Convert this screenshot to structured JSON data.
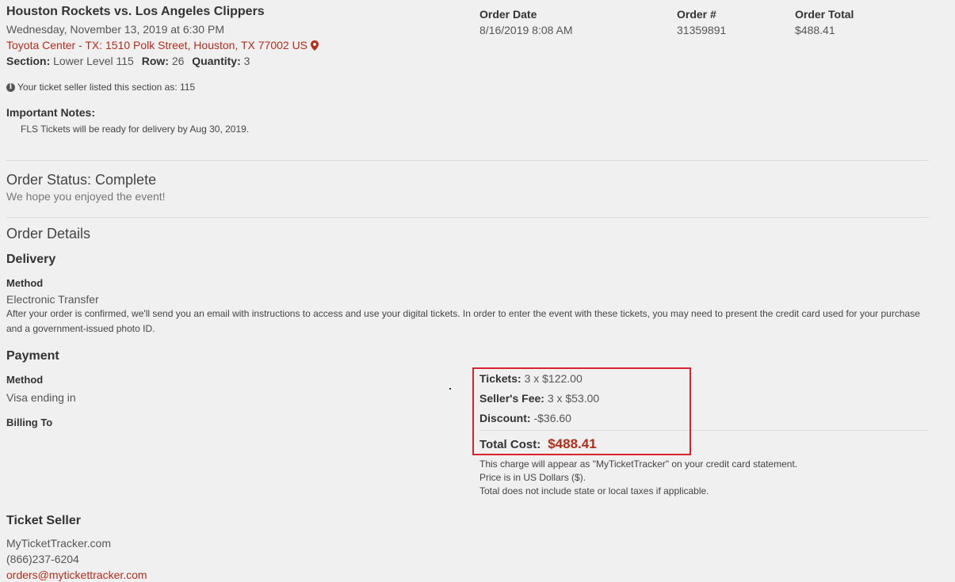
{
  "event": {
    "title": "Houston Rockets vs. Los Angeles Clippers",
    "date": "Wednesday, November 13, 2019 at 6:30 PM",
    "venue": "Toyota Center - TX: 1510 Polk Street, Houston, TX 77002 US",
    "venue_icon": "map-marker-icon",
    "section_label": "Section:",
    "section_value": "Lower Level 115",
    "row_label": "Row:",
    "row_value": "26",
    "quantity_label": "Quantity:",
    "quantity_value": "3",
    "seller_note_icon": "info-circle-icon",
    "seller_note": "Your ticket seller listed this section as: 115",
    "notes_heading": "Important Notes:",
    "notes_text": "FLS Tickets will be ready for delivery by Aug 30, 2019."
  },
  "order_summary": {
    "date_label": "Order Date",
    "date_value": "8/16/2019 8:08 AM",
    "number_label": "Order #",
    "number_value": "31359891",
    "total_label": "Order Total",
    "total_value": "$488.41"
  },
  "status": {
    "title": "Order Status: Complete",
    "subtitle": "We hope you enjoyed the event!"
  },
  "details": {
    "title": "Order Details",
    "delivery": {
      "title": "Delivery",
      "method_label": "Method",
      "method_value": "Electronic Transfer",
      "description": "After your order is confirmed, we'll send you an email with instructions to access and use your digital tickets. In order to enter the event with these tickets, you may need to present the credit card used for your purchase and a government-issued photo ID."
    },
    "payment": {
      "title": "Payment",
      "method_label": "Method",
      "method_value": "Visa ending in",
      "billing_label": "Billing To"
    },
    "costs": {
      "tickets_label": "Tickets:",
      "tickets_value": "3 x $122.00",
      "fee_label": "Seller's Fee:",
      "fee_value": "3 x $53.00",
      "discount_label": "Discount:",
      "discount_value": "-$36.60",
      "total_label": "Total Cost:",
      "total_value": "$488.41",
      "fine_print_1": "This charge will appear as \"MyTicketTracker\" on your credit card statement.",
      "fine_print_2": "Price is in US Dollars ($).",
      "fine_print_3": "Total does not include state or local taxes if applicable."
    }
  },
  "ticket_seller": {
    "title": "Ticket Seller",
    "name": "MyTicketTracker.com",
    "phone": "(866)237-6204",
    "email": "orders@mytickettracker.com"
  },
  "colors": {
    "accent_red": "#b32d1c",
    "highlight_box": "#d9232e",
    "background": "#f0f0f0"
  }
}
